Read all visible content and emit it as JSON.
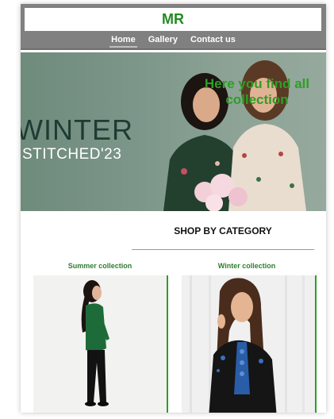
{
  "header": {
    "logo": "MR",
    "nav": [
      {
        "label": "Home"
      },
      {
        "label": "Gallery"
      },
      {
        "label": "Contact us"
      }
    ]
  },
  "hero": {
    "title_line1": "WINTER",
    "title_line2": "STITCHED'23",
    "tagline": "Here you find all collection"
  },
  "section": {
    "title": "SHOP BY CATEGORY"
  },
  "categories": [
    {
      "label": "Summer collection"
    },
    {
      "label": "Winter collection"
    }
  ],
  "colors": {
    "accent_green": "#2e9e25",
    "header_gray": "#808080"
  }
}
